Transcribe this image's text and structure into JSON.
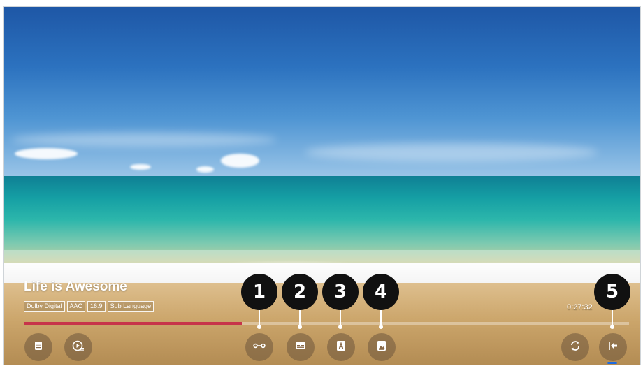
{
  "video": {
    "title": "Life is Awesome",
    "badges": [
      "Dolby Digital",
      "AAC",
      "16:9",
      "Sub Language"
    ],
    "time": "0:27:32",
    "progress_fraction": 0.36
  },
  "controls": {
    "left": [
      {
        "name": "playlist-button",
        "icon": "list-icon"
      },
      {
        "name": "play-options-button",
        "icon": "play-settings-icon"
      }
    ],
    "center": [
      {
        "name": "ab-repeat-button",
        "icon": "ab-icon"
      },
      {
        "name": "subtitle-button",
        "icon": "subtitle-icon"
      },
      {
        "name": "audio-language-button",
        "icon": "audio-language-icon"
      },
      {
        "name": "picture-button",
        "icon": "picture-icon"
      }
    ],
    "right": [
      {
        "name": "repeat-button",
        "icon": "repeat-icon"
      },
      {
        "name": "back-button",
        "icon": "back-arrow-icon"
      }
    ]
  },
  "callouts": [
    "1",
    "2",
    "3",
    "4",
    "5"
  ],
  "colors": {
    "progress": "#c7344a",
    "callout_bg": "#111111",
    "focus": "#1e6be0"
  }
}
